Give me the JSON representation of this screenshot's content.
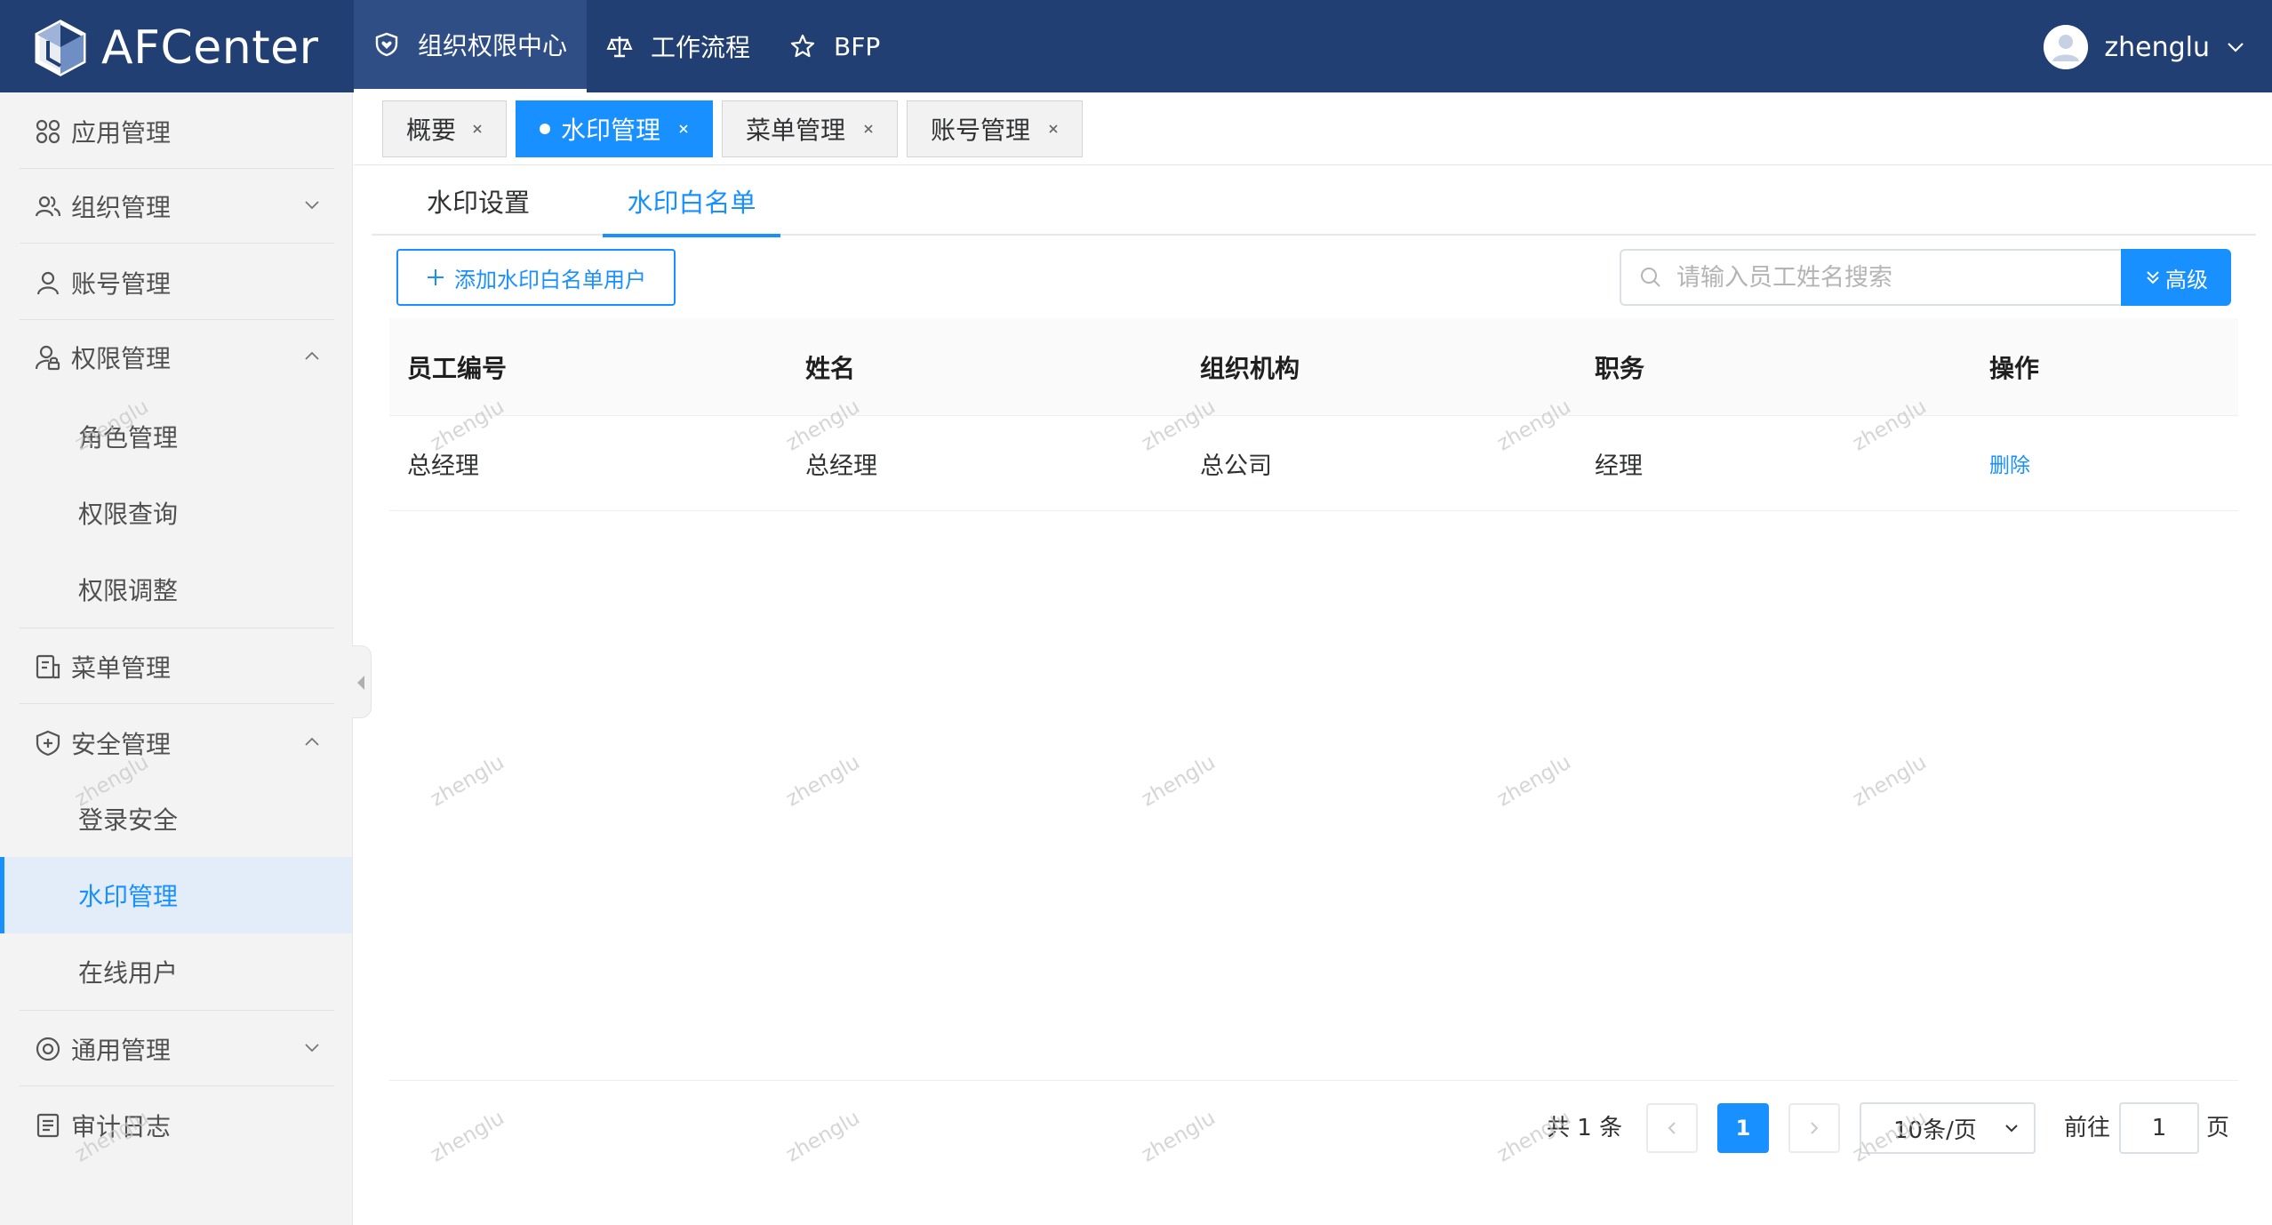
{
  "app": {
    "name": "AFCenter"
  },
  "top_nav": [
    {
      "label": "组织权限中心",
      "icon": "shield-heart-icon",
      "active": true
    },
    {
      "label": "工作流程",
      "icon": "scale-icon",
      "active": false
    },
    {
      "label": "BFP",
      "icon": "star-icon",
      "active": false
    }
  ],
  "user": {
    "name": "zhenglu"
  },
  "sidebar": {
    "items": [
      {
        "label": "应用管理",
        "icon": "apps-grid-icon"
      },
      {
        "label": "组织管理",
        "icon": "team-icon",
        "expanded": false
      },
      {
        "label": "账号管理",
        "icon": "user-icon"
      },
      {
        "label": "权限管理",
        "icon": "permission-user-icon",
        "expanded": true,
        "children": [
          "角色管理",
          "权限查询",
          "权限调整"
        ]
      },
      {
        "label": "菜单管理",
        "icon": "menu-doc-icon"
      },
      {
        "label": "安全管理",
        "icon": "shield-plus-icon",
        "expanded": true,
        "children": [
          "登录安全",
          "水印管理",
          "在线用户"
        ],
        "active_child": "水印管理"
      },
      {
        "label": "通用管理",
        "icon": "settings-icon",
        "expanded": false
      },
      {
        "label": "审计日志",
        "icon": "log-icon"
      }
    ]
  },
  "page_tabs": [
    {
      "label": "概要",
      "active": false
    },
    {
      "label": "水印管理",
      "active": true
    },
    {
      "label": "菜单管理",
      "active": false
    },
    {
      "label": "账号管理",
      "active": false
    }
  ],
  "inner_tabs": [
    {
      "label": "水印设置",
      "active": false
    },
    {
      "label": "水印白名单",
      "active": true
    }
  ],
  "toolbar": {
    "add_label": "添加水印白名单用户",
    "search_placeholder": "请输入员工姓名搜索",
    "advanced_label": "高级"
  },
  "table": {
    "columns": [
      "员工编号",
      "姓名",
      "组织机构",
      "职务",
      "操作"
    ],
    "rows": [
      {
        "id": "总经理",
        "name": "总经理",
        "org": "总公司",
        "position": "经理",
        "action": "删除"
      }
    ]
  },
  "pagination": {
    "total_text": "共 1 条",
    "current_page": "1",
    "page_size": "10条/页",
    "goto_label": "前往",
    "goto_value": "1",
    "page_suffix": "页"
  },
  "watermark": {
    "text": "zhenglu"
  },
  "colors": {
    "header_bg": "#213f72",
    "accent": "#1890ff",
    "sidebar_bg": "#f3f3f3"
  }
}
